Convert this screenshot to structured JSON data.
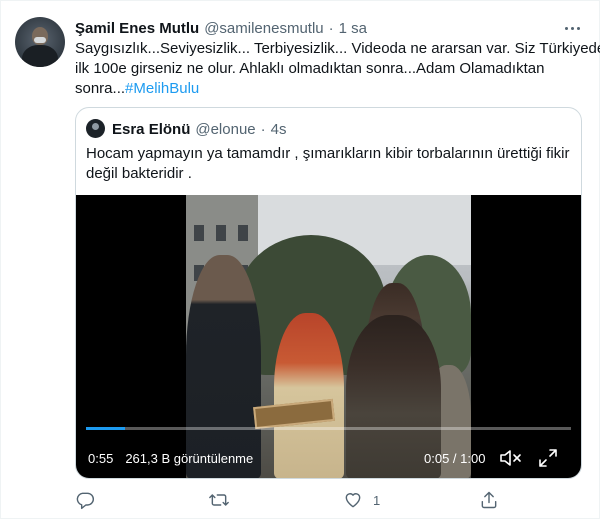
{
  "tweet": {
    "author_name": "Şamil Enes Mutlu",
    "author_handle": "@samilenesmutlu",
    "separator": "·",
    "time": "1 sa",
    "text_line1": "Saygısızlık...Seviyesizlik... Terbiyesizlik... Videoda ne ararsan var. Siz Türkiyede",
    "text_line2": "ilk 100e  girseniz ne olur. Ahlaklı olmadıktan sonra...Adam Olamadıktan",
    "text_line3_prefix": "sonra...",
    "hashtag": "#MelihBulu"
  },
  "quoted": {
    "author_name": "Esra Elönü",
    "author_handle": "@elonue",
    "separator": "·",
    "time": "4s",
    "text_line1": "Hocam yapmayın ya tamamdır , şımarıkların kibir torbalarının ürettiği fikir",
    "text_line2": "değil bakteridir ."
  },
  "video": {
    "elapsed": "0:55",
    "views": "261,3 B görüntülenme",
    "position": "0:05",
    "duration": "1:00",
    "progress_fraction": 0.08,
    "mute_icon": "volume-muted-icon",
    "fullscreen_icon": "fullscreen-icon"
  },
  "actions": {
    "reply_icon": "reply-icon",
    "retweet_icon": "retweet-icon",
    "like_icon": "heart-icon",
    "like_count": "1",
    "share_icon": "share-icon"
  },
  "colors": {
    "accent": "#1d9bf0",
    "text": "#0f1419",
    "secondary": "#536471",
    "border": "#cfd9de"
  }
}
